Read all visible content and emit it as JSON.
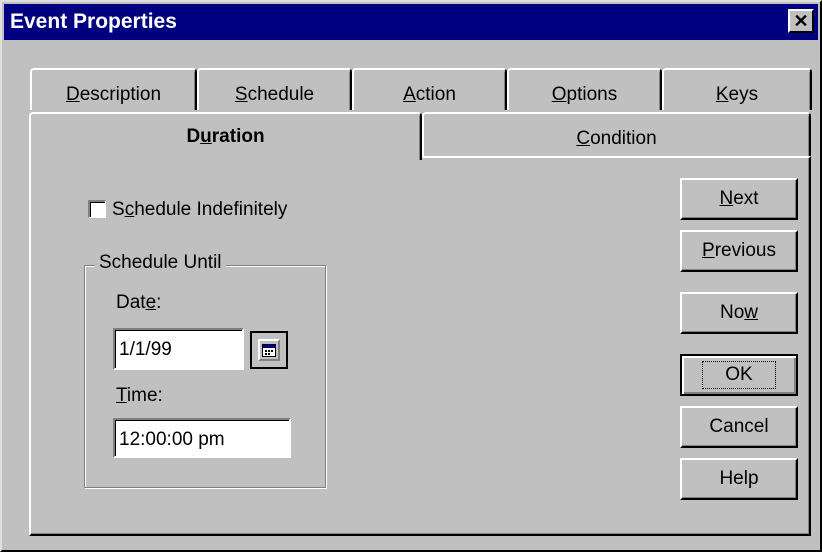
{
  "window": {
    "title": "Event Properties",
    "close_symbol": "✕"
  },
  "tabs_row1": [
    {
      "pre": "",
      "key": "D",
      "post": "escription"
    },
    {
      "pre": "",
      "key": "S",
      "post": "chedule"
    },
    {
      "pre": "",
      "key": "A",
      "post": "ction"
    },
    {
      "pre": "",
      "key": "O",
      "post": "ptions"
    },
    {
      "pre": "",
      "key": "K",
      "post": "eys"
    }
  ],
  "tabs_row2": [
    {
      "pre": "D",
      "key": "u",
      "post": "ration",
      "active": true
    },
    {
      "pre": "",
      "key": "C",
      "post": "ondition",
      "active": false
    }
  ],
  "duration": {
    "indefinite_checkbox": {
      "pre": "S",
      "key": "c",
      "post": "hedule Indefinitely",
      "checked": false
    },
    "group_title": "Schedule Until",
    "date_label": {
      "pre": "Dat",
      "key": "e",
      "post": ":"
    },
    "date_value": "1/1/99",
    "time_label": {
      "pre": "",
      "key": "T",
      "post": "ime:"
    },
    "time_value": "12:00:00 pm"
  },
  "buttons": {
    "next": {
      "pre": "",
      "key": "N",
      "post": "ext"
    },
    "previous": {
      "pre": "",
      "key": "P",
      "post": "revious"
    },
    "now": {
      "pre": "No",
      "key": "w",
      "post": ""
    },
    "ok": "OK",
    "cancel": "Cancel",
    "help": "Help"
  },
  "icons": {
    "calendar": "calendar-icon",
    "close": "close-icon"
  }
}
